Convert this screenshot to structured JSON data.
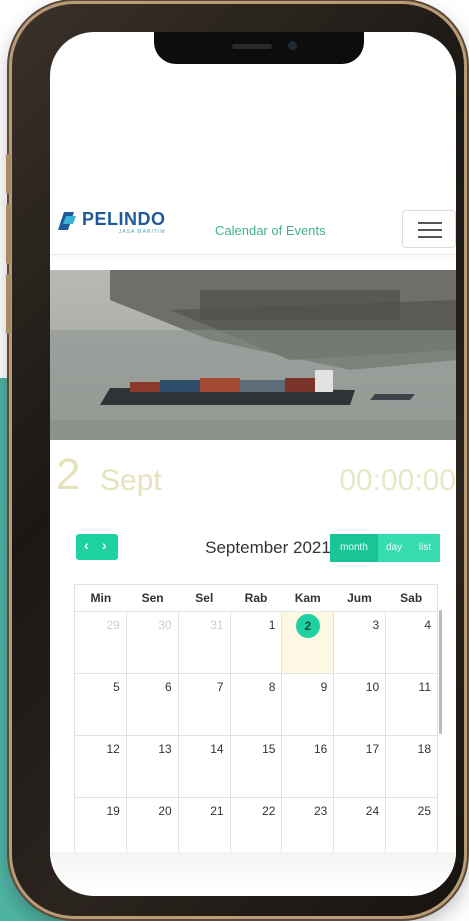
{
  "header": {
    "logo_name": "PELINDO",
    "logo_sub": "JASA MARITIM",
    "title": "Calendar of Events",
    "menu_icon": "hamburger-icon"
  },
  "hero": {
    "icon": "port-photo"
  },
  "date_display": {
    "day": "2",
    "month": "Sept",
    "time": "00:00:00"
  },
  "calendar": {
    "title": "September 2021",
    "nav": {
      "prev": "‹",
      "next": "›"
    },
    "views": [
      "month",
      "day",
      "list"
    ],
    "active_view": "month",
    "weekdays": [
      "Min",
      "Sen",
      "Sel",
      "Rab",
      "Kam",
      "Jum",
      "Sab"
    ],
    "weeks": [
      [
        "29",
        "30",
        "31",
        "1",
        "2",
        "3",
        "4"
      ],
      [
        "5",
        "6",
        "7",
        "8",
        "9",
        "10",
        "11"
      ],
      [
        "12",
        "13",
        "14",
        "15",
        "16",
        "17",
        "18"
      ],
      [
        "19",
        "20",
        "21",
        "22",
        "23",
        "24",
        "25"
      ]
    ],
    "other_month": [
      [
        0,
        0
      ],
      [
        0,
        1
      ],
      [
        0,
        2
      ]
    ],
    "today": [
      0,
      4
    ]
  },
  "colors": {
    "accent": "#1dd1a1",
    "teal_bg": "#4fb3a3",
    "today_bg": "#fcf8e3"
  }
}
